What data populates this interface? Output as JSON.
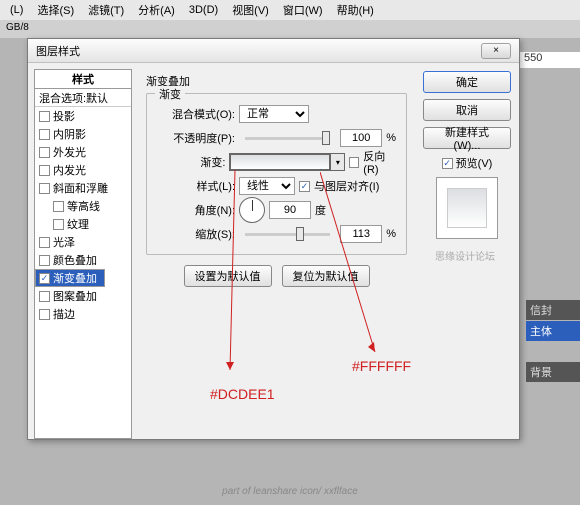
{
  "menu": {
    "items": [
      "(L)",
      "选择(S)",
      "滤镜(T)",
      "分析(A)",
      "3D(D)",
      "视图(V)",
      "窗口(W)",
      "帮助(H)"
    ]
  },
  "doc_tab": "GB/8",
  "ruler_mark": "550",
  "dialog": {
    "title": "图层样式",
    "close": "×",
    "left": {
      "header": "样式",
      "blend_defaults": "混合选项:默认",
      "items": [
        {
          "label": "投影",
          "checked": false
        },
        {
          "label": "内阴影",
          "checked": false
        },
        {
          "label": "外发光",
          "checked": false
        },
        {
          "label": "内发光",
          "checked": false
        },
        {
          "label": "斜面和浮雕",
          "checked": false
        },
        {
          "label": "等高线",
          "checked": false,
          "indent": true
        },
        {
          "label": "纹理",
          "checked": false,
          "indent": true
        },
        {
          "label": "光泽",
          "checked": false
        },
        {
          "label": "颜色叠加",
          "checked": false
        },
        {
          "label": "渐变叠加",
          "checked": true,
          "selected": true
        },
        {
          "label": "图案叠加",
          "checked": false
        },
        {
          "label": "描边",
          "checked": false
        }
      ]
    },
    "mid": {
      "section_title": "渐变叠加",
      "group_legend": "渐变",
      "blend_mode": {
        "label": "混合模式(O):",
        "value": "正常"
      },
      "opacity": {
        "label": "不透明度(P):",
        "value": "100",
        "unit": "%"
      },
      "gradient": {
        "label": "渐变:",
        "reverse_cb": "反向(R)",
        "dd": "▾"
      },
      "style": {
        "label": "样式(L):",
        "value": "线性",
        "align_cb": "与图层对齐(I)"
      },
      "angle": {
        "label": "角度(N):",
        "value": "90",
        "unit": "度"
      },
      "scale": {
        "label": "缩放(S):",
        "value": "113",
        "unit": "%"
      },
      "btn_default": "设置为默认值",
      "btn_reset": "复位为默认值"
    },
    "right": {
      "ok": "确定",
      "cancel": "取消",
      "new_style": "新建样式(W)...",
      "preview": "预览(V)"
    }
  },
  "annotations": {
    "color1": "#DCDEE1",
    "color2": "#FFFFFF"
  },
  "watermark": "思缘设计论坛",
  "side": {
    "t1": "信封",
    "t2": "主体",
    "t3": "背景"
  },
  "footer": "part of leanshare icon/ xxflface"
}
